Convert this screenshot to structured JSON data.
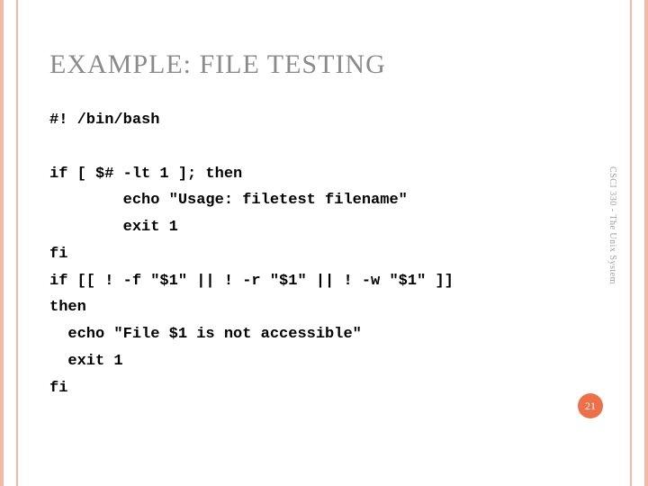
{
  "slide": {
    "title": "EXAMPLE: FILE TESTING",
    "code": "#! /bin/bash\n\nif [ $# -lt 1 ]; then\n        echo \"Usage: filetest filename\"\n        exit 1\nfi\nif [[ ! -f \"$1\" || ! -r \"$1\" || ! -w \"$1\" ]]\nthen\n  echo \"File $1 is not accessible\"\n  exit 1\nfi",
    "side_label": "CSCI 330 - The Unix System",
    "page_number": "21"
  },
  "colors": {
    "accent_border": "#f2b9a6",
    "title_text": "#8a8a8a",
    "badge_bg": "#ec704a",
    "badge_text": "#ffffff"
  }
}
